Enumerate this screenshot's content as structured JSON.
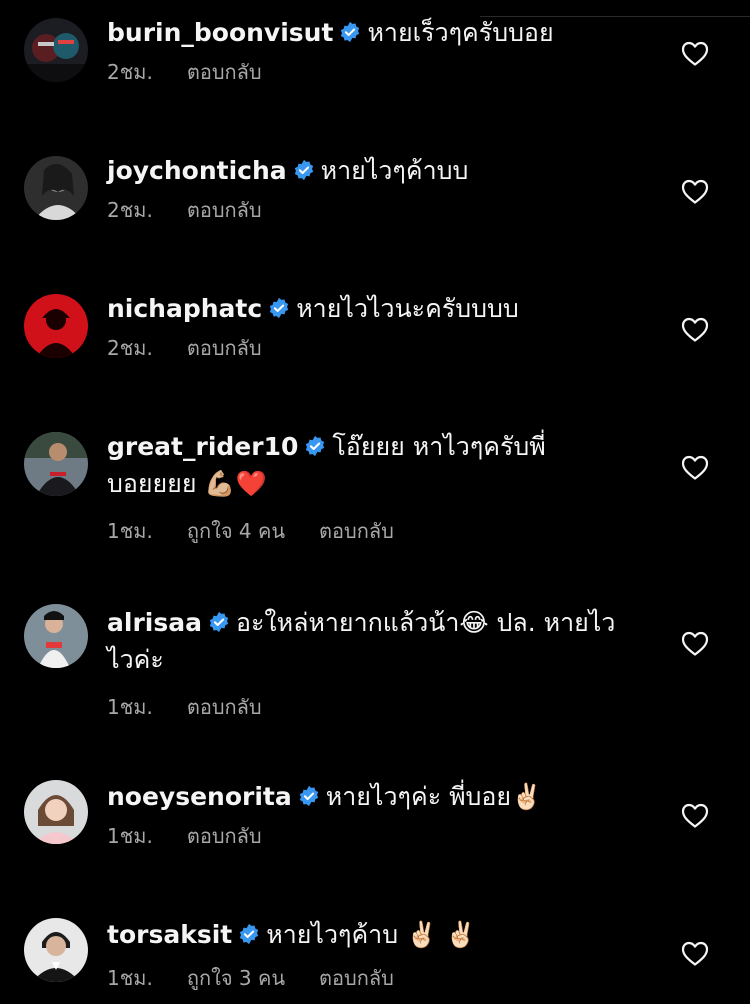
{
  "colors": {
    "background": "#000000",
    "text": "#f5f5f5",
    "meta_text": "#a8a8a8",
    "verified_badge": "#3897f0"
  },
  "comments": [
    {
      "username": "burin_boonvisut",
      "verified": true,
      "text": "หายเร็วๆครับบอย",
      "time": "2ชม.",
      "likes": "",
      "reply": "ตอบกลับ"
    },
    {
      "username": "joychonticha",
      "verified": true,
      "text": "หายไวๆค้าบบ",
      "time": "2ชม.",
      "likes": "",
      "reply": "ตอบกลับ"
    },
    {
      "username": "nichaphatc",
      "verified": true,
      "text": "หายไวไวนะครับบบบ",
      "time": "2ชม.",
      "likes": "",
      "reply": "ตอบกลับ"
    },
    {
      "username": "great_rider10",
      "verified": true,
      "text": "โอ๊ยยย หาไวๆครับพี่บอยยยย 💪🏼❤️",
      "time": "1ชม.",
      "likes": "ถูกใจ 4 คน",
      "reply": "ตอบกลับ"
    },
    {
      "username": "alrisaa",
      "verified": true,
      "text": "อะใหล่หายากแล้วน้า😂  ปล. หายไวไวค่ะ",
      "time": "1ชม.",
      "likes": "",
      "reply": "ตอบกลับ"
    },
    {
      "username": "noeysenorita",
      "verified": true,
      "text": "หายไวๆค่ะ พี่บอย✌🏻",
      "time": "1ชม.",
      "likes": "",
      "reply": "ตอบกลับ"
    },
    {
      "username": "torsaksit",
      "verified": true,
      "text": "หายไวๆค้าบ ✌🏻 ✌🏻",
      "time": "1ชม.",
      "likes": "ถูกใจ 3 คน",
      "reply": "ตอบกลับ"
    }
  ]
}
